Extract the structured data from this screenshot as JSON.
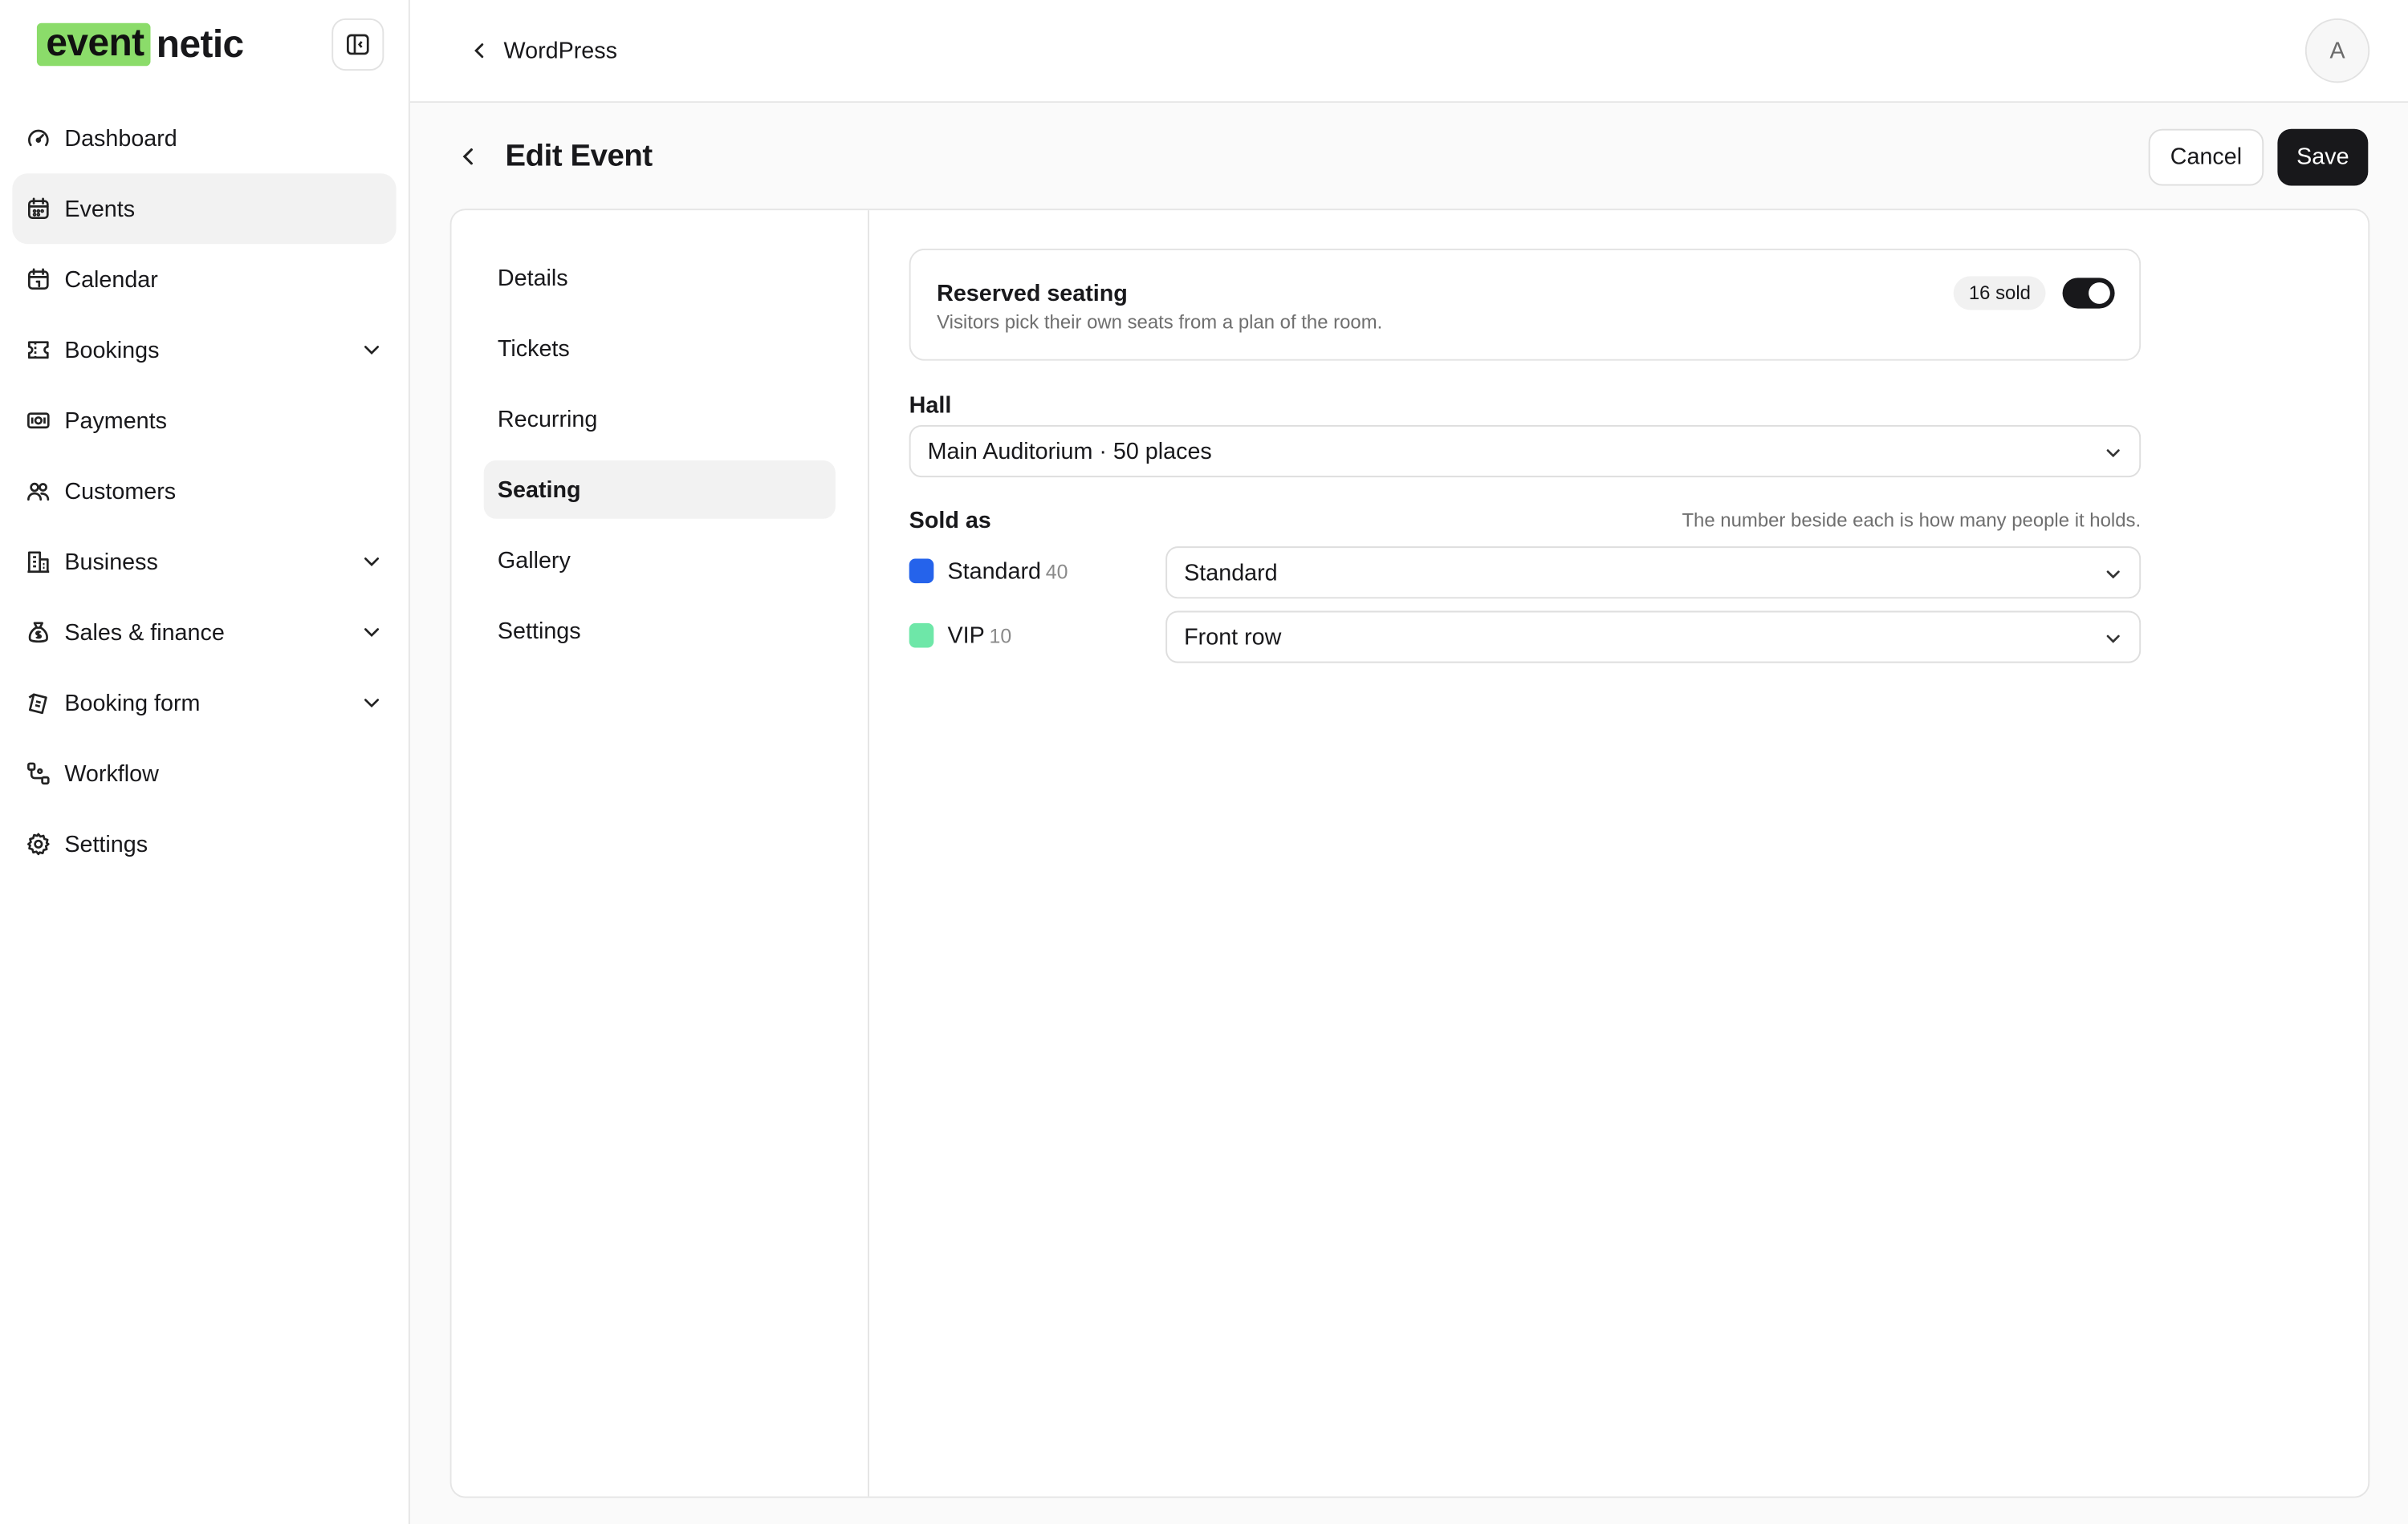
{
  "brand": {
    "logo_highlight": "event",
    "logo_rest": "netic",
    "accent": "#8bdc6a"
  },
  "sidebar": {
    "items": [
      {
        "label": "Dashboard",
        "icon": "gauge-icon",
        "active": false,
        "expandable": false
      },
      {
        "label": "Events",
        "icon": "calendar-icon",
        "active": true,
        "expandable": false
      },
      {
        "label": "Calendar",
        "icon": "calendar-grid-icon",
        "active": false,
        "expandable": false
      },
      {
        "label": "Bookings",
        "icon": "ticket-icon",
        "active": false,
        "expandable": true
      },
      {
        "label": "Payments",
        "icon": "banknote-icon",
        "active": false,
        "expandable": false
      },
      {
        "label": "Customers",
        "icon": "users-icon",
        "active": false,
        "expandable": false
      },
      {
        "label": "Business",
        "icon": "building-icon",
        "active": false,
        "expandable": true
      },
      {
        "label": "Sales & finance",
        "icon": "money-bag-icon",
        "active": false,
        "expandable": true
      },
      {
        "label": "Booking form",
        "icon": "form-icon",
        "active": false,
        "expandable": true
      },
      {
        "label": "Workflow",
        "icon": "workflow-icon",
        "active": false,
        "expandable": false
      },
      {
        "label": "Settings",
        "icon": "gear-icon",
        "active": false,
        "expandable": false
      }
    ]
  },
  "topbar": {
    "back_label": "WordPress",
    "avatar_initial": "A"
  },
  "page": {
    "title": "Edit Event",
    "cancel_label": "Cancel",
    "save_label": "Save"
  },
  "subnav": {
    "items": [
      {
        "label": "Details",
        "active": false
      },
      {
        "label": "Tickets",
        "active": false
      },
      {
        "label": "Recurring",
        "active": false
      },
      {
        "label": "Seating",
        "active": true
      },
      {
        "label": "Gallery",
        "active": false
      },
      {
        "label": "Settings",
        "active": false
      }
    ]
  },
  "seating": {
    "reserved": {
      "title": "Reserved seating",
      "description": "Visitors pick their own seats from a plan of the room.",
      "badge": "16 sold",
      "enabled": true
    },
    "hall_label": "Hall",
    "hall_value": "Main Auditorium · 50 places",
    "sold_as_label": "Sold as",
    "sold_as_hint": "The number beside each is how many people it holds.",
    "rows": [
      {
        "name": "Standard",
        "count": "40",
        "color": "#2563eb",
        "value": "Standard"
      },
      {
        "name": "VIP",
        "count": "10",
        "color": "#6ee7a8",
        "value": "Front row"
      }
    ]
  }
}
